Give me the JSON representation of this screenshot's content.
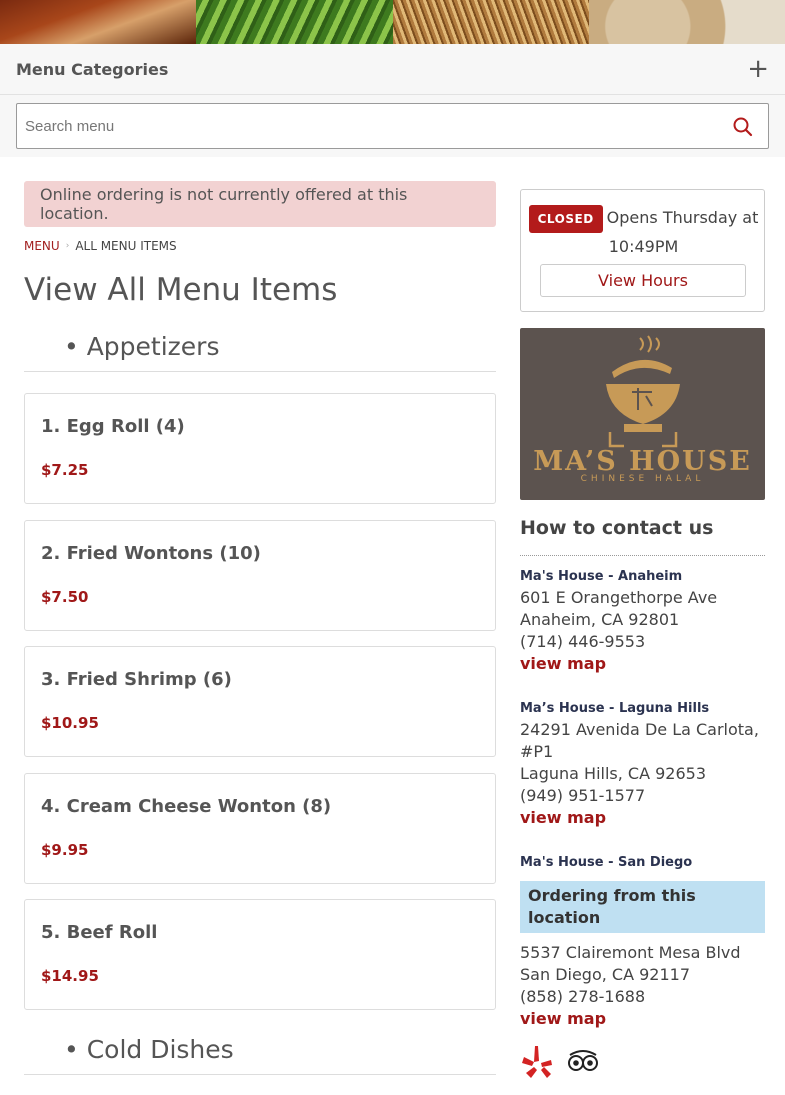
{
  "hero": {
    "tiles": [
      "hero-photo-1",
      "hero-photo-2",
      "hero-photo-3",
      "hero-photo-4"
    ]
  },
  "categories_bar": {
    "label": "Menu Categories",
    "expand_icon": "plus-icon"
  },
  "search": {
    "placeholder": "Search menu",
    "value": "",
    "icon": "search-icon"
  },
  "alert": {
    "text": "Online ordering is not currently offered at this location."
  },
  "breadcrumb": {
    "menu": "Menu",
    "current": "All Menu Items"
  },
  "page_title": "View All Menu Items",
  "sections": [
    {
      "title": "• Appetizers"
    },
    {
      "title": "• Cold Dishes"
    }
  ],
  "items": [
    {
      "name": "1. Egg Roll (4)",
      "price": "$7.25"
    },
    {
      "name": "2. Fried Wontons (10)",
      "price": "$7.50"
    },
    {
      "name": "3. Fried Shrimp (6)",
      "price": "$10.95"
    },
    {
      "name": "4. Cream Cheese Wonton (8)",
      "price": "$9.95"
    },
    {
      "name": "5. Beef Roll",
      "price": "$14.95"
    }
  ],
  "status": {
    "badge": "CLOSED",
    "opens": "Opens Thursday at 10:49PM",
    "view_hours": "View Hours"
  },
  "logo": {
    "brand": "MA’S HOUSE",
    "sub": "CHINESE HALAL"
  },
  "contact": {
    "title": "How to contact us",
    "locations": [
      {
        "name": "Ma's House - Anaheim",
        "address1": "601 E Orangethorpe Ave",
        "address2": "Anaheim, CA 92801",
        "phone": "(714) 446-9553",
        "map": "view map"
      },
      {
        "name": "Ma’s House - Laguna Hills",
        "address1": "24291 Avenida De La Carlota, #P1",
        "address2": "Laguna Hills, CA 92653",
        "phone": "(949) 951-1577",
        "map": "view map"
      },
      {
        "name": "Ma's House - San Diego",
        "ordering": "Ordering from this location",
        "address1": "5537 Clairemont Mesa Blvd",
        "address2": "San Diego, CA 92117",
        "phone": "(858) 278-1688",
        "map": "view map"
      }
    ]
  },
  "social": [
    "yelp-icon",
    "tripadvisor-icon"
  ],
  "colors": {
    "accent": "#a01818",
    "alert_bg": "#f2d2d2",
    "ordering_bg": "#bfe0f2",
    "logo_bg": "#5c534f",
    "logo_gold": "#c79a57"
  }
}
